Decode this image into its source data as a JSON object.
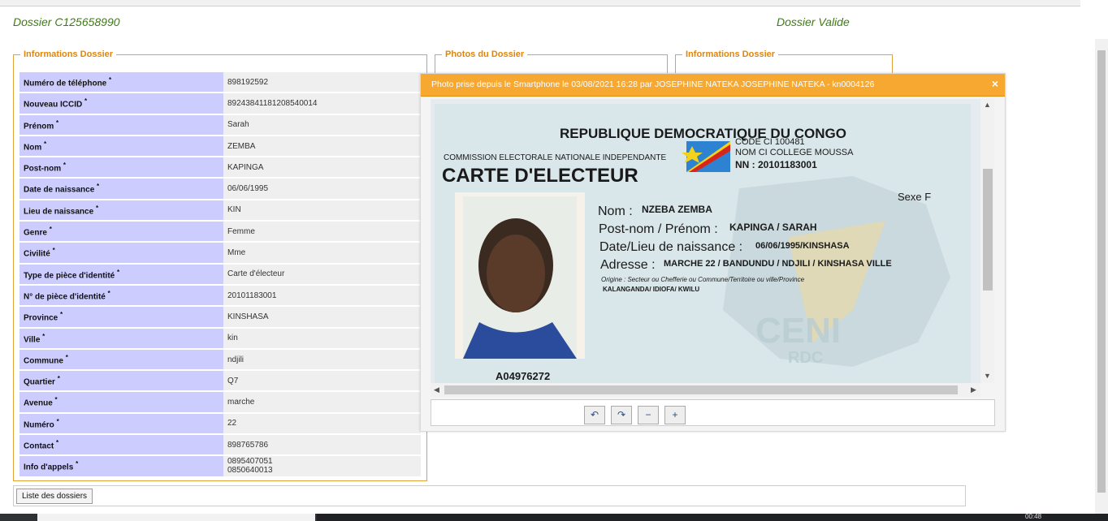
{
  "header": {
    "dossier_id": "Dossier C125658990",
    "status": "Dossier Valide"
  },
  "sections": {
    "info_dossier": "Informations Dossier",
    "photos_dossier": "Photos du Dossier",
    "info_dossier_right": "Informations Dossier"
  },
  "fields": [
    {
      "label": "Numéro de téléphone",
      "value": "898192592"
    },
    {
      "label": "Nouveau ICCID",
      "value": "89243841181208540014"
    },
    {
      "label": "Prénom",
      "value": "Sarah"
    },
    {
      "label": "Nom",
      "value": "ZEMBA"
    },
    {
      "label": "Post-nom",
      "value": "KAPINGA"
    },
    {
      "label": "Date de naissance",
      "value": "06/06/1995"
    },
    {
      "label": "Lieu de naissance",
      "value": "KIN"
    },
    {
      "label": "Genre",
      "value": "Femme"
    },
    {
      "label": "Civilité",
      "value": "Mme"
    },
    {
      "label": "Type de pièce d'identité",
      "value": "Carte d'électeur"
    },
    {
      "label": "N° de pièce d'identité",
      "value": "20101183001"
    },
    {
      "label": "Province",
      "value": "KINSHASA"
    },
    {
      "label": "Ville",
      "value": "kin"
    },
    {
      "label": "Commune",
      "value": "ndjili"
    },
    {
      "label": "Quartier",
      "value": "Q7"
    },
    {
      "label": "Avenue",
      "value": "marche"
    },
    {
      "label": "Numéro",
      "value": "22"
    },
    {
      "label": "Contact",
      "value": "898765786"
    },
    {
      "label": "Info d'appels",
      "value_lines": [
        "0895407051",
        "0850640013"
      ]
    }
  ],
  "required_marker": "*",
  "dialog": {
    "title": "Photo prise depuis le Smartphone le 03/08/2021 16:28 par JOSEPHINE NATEKA JOSEPHINE NATEKA - kn0004126",
    "close": "×"
  },
  "id_card": {
    "country": "REPUBLIQUE DEMOCRATIQUE DU CONGO",
    "commission": "COMMISSION ELECTORALE NATIONALE INDEPENDANTE",
    "card_type": "CARTE D'ELECTEUR",
    "code_ci": "CODE CI 100481",
    "nom_ci": "NOM CI COLLEGE MOUSSA",
    "nn": "NN : 20101183001",
    "sexe": "Sexe F",
    "nom_label": "Nom :",
    "nom_value": "NZEBA ZEMBA",
    "postnom_label": "Post-nom / Prénom :",
    "postnom_value": "KAPINGA / SARAH",
    "date_label": "Date/Lieu de naissance :",
    "date_value": "06/06/1995/KINSHASA",
    "adresse_label": "Adresse :",
    "adresse_value": "MARCHE 22 / BANDUNDU / NDJILI / KINSHASA VILLE",
    "origine": "Origine : Secteur ou Chefferie ou Commune/Territoire ou ville/Province",
    "origine_value": "KALANGANDA/ IDIOFA/ KWILU",
    "serial": "A04976272",
    "watermark": "CENI",
    "watermark2": "RDC"
  },
  "toolbar_buttons": [
    {
      "name": "rotate-left-icon",
      "glyph": "↶"
    },
    {
      "name": "rotate-right-icon",
      "glyph": "↷"
    },
    {
      "name": "zoom-out-icon",
      "glyph": "−"
    },
    {
      "name": "zoom-in-icon",
      "glyph": "+"
    }
  ],
  "footer": {
    "list_button": "Liste des dossiers"
  },
  "taskbar": {
    "clock": "00:48"
  }
}
